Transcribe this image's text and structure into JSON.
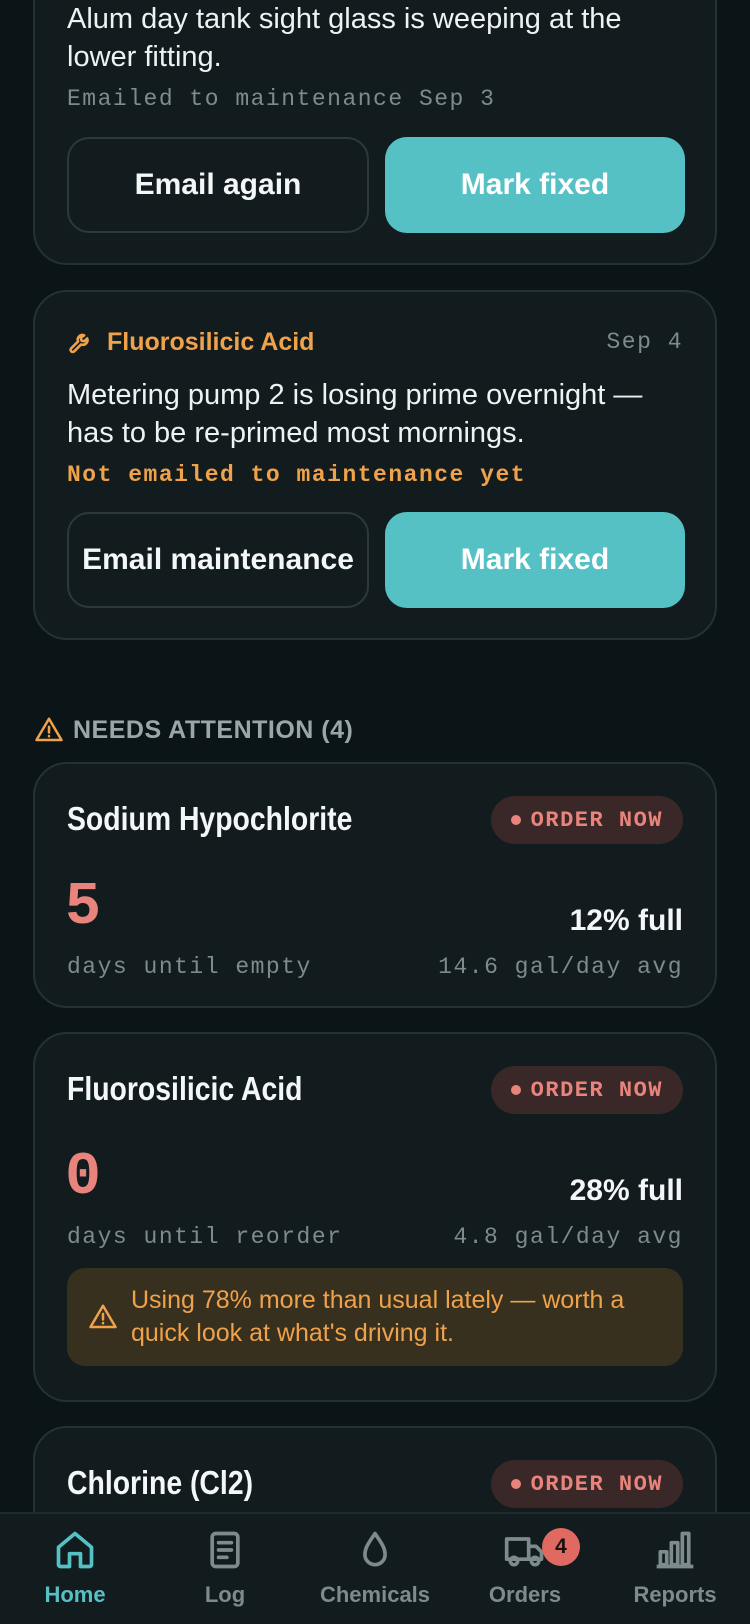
{
  "issues": [
    {
      "text": "Alum day tank sight glass is weeping at the lower fitting.",
      "note": "Emailed to maintenance Sep 3",
      "secondary_label": "Email again",
      "primary_label": "Mark fixed"
    },
    {
      "chemical": "Fluorosilicic Acid",
      "date": "Sep 4",
      "icon": "wrench-icon",
      "text": "Metering pump 2 is losing prime overnight — has to be re-primed most mornings.",
      "note": "Not emailed to maintenance yet",
      "secondary_label": "Email maintenance",
      "primary_label": "Mark fixed"
    }
  ],
  "attention": {
    "title": "NEEDS ATTENTION (4)",
    "items": [
      {
        "name": "Sodium Hypochlorite",
        "badge": "ORDER NOW",
        "days": "5",
        "days_label": "days until empty",
        "fill": "12% full",
        "rate": "14.6 gal/day avg"
      },
      {
        "name": "Fluorosilicic Acid",
        "badge": "ORDER NOW",
        "days": "0",
        "days_label": "days until reorder",
        "fill": "28% full",
        "rate": "4.8 gal/day avg",
        "alert": "Using 78% more than usual lately — worth a quick look at what's driving it."
      },
      {
        "name": "Chlorine (Cl2)",
        "badge": "ORDER NOW"
      }
    ]
  },
  "nav": {
    "items": [
      {
        "label": "Home",
        "icon": "home-icon",
        "active": true
      },
      {
        "label": "Log",
        "icon": "log-icon"
      },
      {
        "label": "Chemicals",
        "icon": "droplet-icon"
      },
      {
        "label": "Orders",
        "icon": "truck-icon",
        "badge": "4"
      },
      {
        "label": "Reports",
        "icon": "bar-chart-icon"
      }
    ]
  },
  "colors": {
    "accent": "#56c1c5",
    "warning": "#f0a24a",
    "danger": "#e9847c",
    "background": "#0b1416",
    "card": "#121c1e"
  }
}
